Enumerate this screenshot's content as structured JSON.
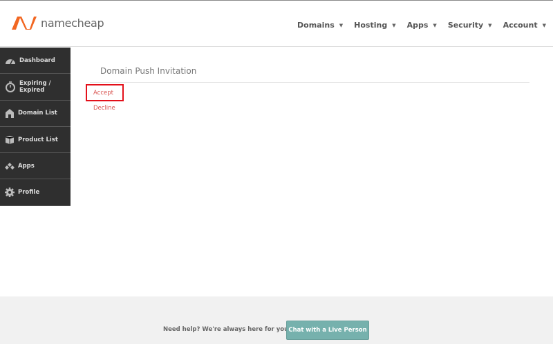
{
  "brand": {
    "name": "namecheap",
    "accent": "#f26722"
  },
  "nav": [
    {
      "label": "Domains"
    },
    {
      "label": "Hosting"
    },
    {
      "label": "Apps"
    },
    {
      "label": "Security"
    },
    {
      "label": "Account"
    }
  ],
  "sidebar": {
    "items": [
      {
        "label": "Dashboard",
        "icon": "gauge-icon"
      },
      {
        "label": "Expiring / Expired",
        "icon": "stopwatch-icon"
      },
      {
        "label": "Domain List",
        "icon": "home-icon"
      },
      {
        "label": "Product List",
        "icon": "box-icon"
      },
      {
        "label": "Apps",
        "icon": "apps-icon"
      },
      {
        "label": "Profile",
        "icon": "gear-icon"
      }
    ]
  },
  "main": {
    "title": "Domain Push Invitation",
    "accept": "Accept",
    "decline": "Decline"
  },
  "footer": {
    "help": "Need help? We're always here for you.",
    "chat": "Chat with a Live Person"
  }
}
